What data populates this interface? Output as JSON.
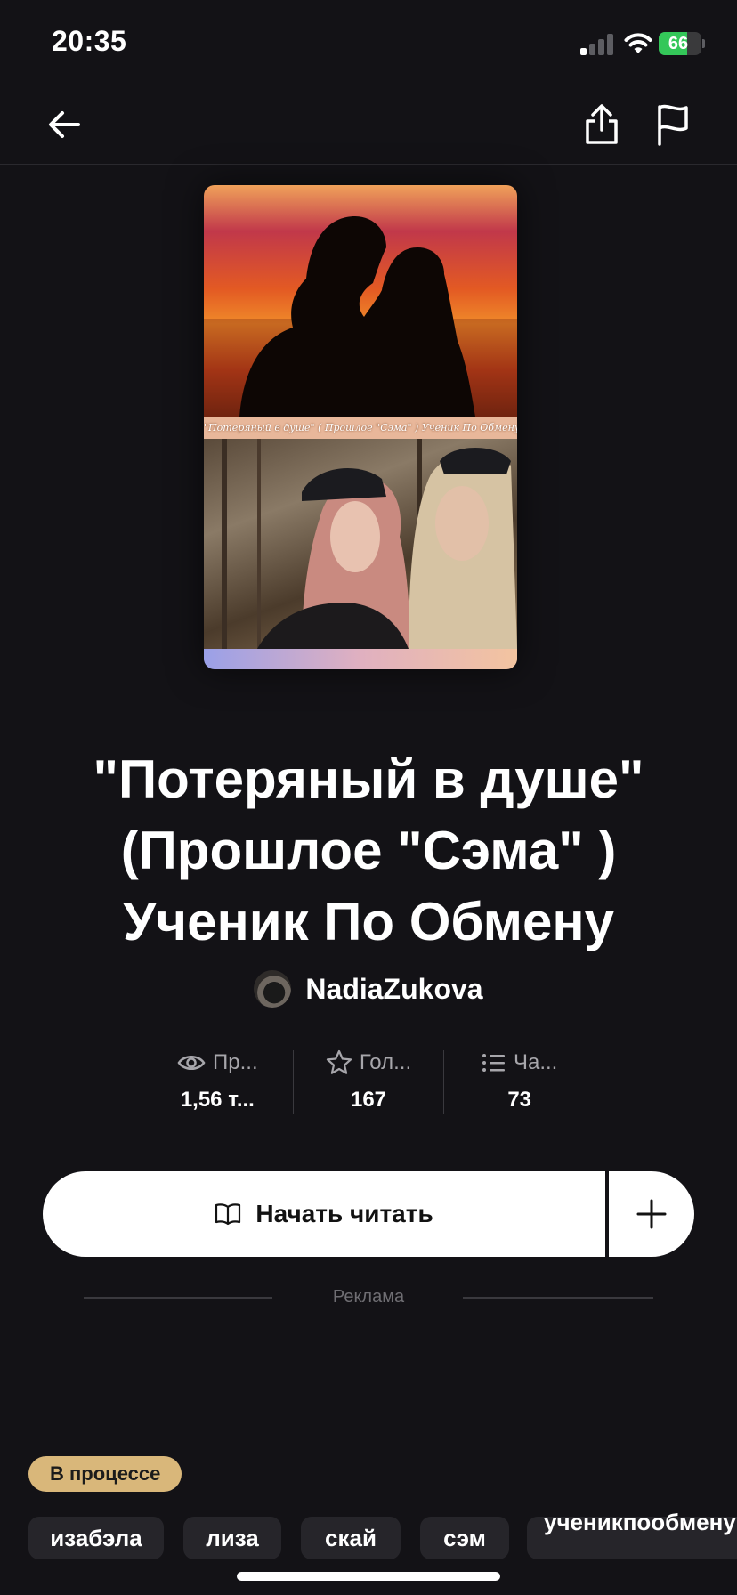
{
  "status_bar": {
    "time": "20:35",
    "battery": "66",
    "battery_level": 66
  },
  "book": {
    "title": "\"Потеряный в душе\" (Прошлое \"Сэма\" ) Ученик По Обмену",
    "cover_caption": "\"Потеряный в душе\" ( Прошлое \"Сэма\" ) Ученик По Обмену",
    "author": "NadiaZukova"
  },
  "stats": [
    {
      "label": "Пр...",
      "value": "1,56 т...",
      "icon": "eye-icon"
    },
    {
      "label": "Гол...",
      "value": "167",
      "icon": "star-icon"
    },
    {
      "label": "Ча...",
      "value": "73",
      "icon": "list-icon"
    }
  ],
  "actions": {
    "start_reading": "Начать читать"
  },
  "ad_label": "Реклама",
  "status_badge": "В процессе",
  "tags": [
    "изабэла",
    "лиза",
    "скай",
    "сэм",
    "ученикпообмену"
  ],
  "colors": {
    "background": "#131216",
    "badge": "#d9b77a",
    "tag_bg": "#26252a",
    "battery": "#34c759"
  }
}
